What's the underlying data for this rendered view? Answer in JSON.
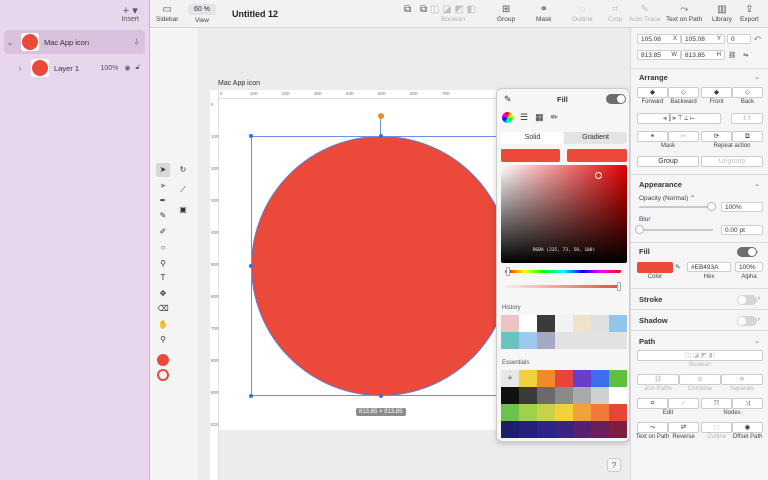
{
  "layers_panel": {
    "insert_label": "Insert",
    "rows": [
      {
        "name": "Mac App icon",
        "opacity": ""
      },
      {
        "name": "Layer 1",
        "opacity": "100%"
      }
    ]
  },
  "toolbar": {
    "sidebar": "Sidebar",
    "zoom_value": "60 %",
    "view": "View",
    "document_title": "Untitled 12",
    "boolean": "Boolean",
    "group": "Group",
    "mask": "Mask",
    "outline": "Outline",
    "crop": "Crop",
    "auto_trace": "Auto Trace",
    "text_on_path": "Text on Path",
    "library": "Library",
    "export": "Export"
  },
  "canvas": {
    "artboard_label": "Mac App icon",
    "size_badge": "813.85 × 813.85",
    "ruler_h": [
      "0",
      "100",
      "200",
      "300",
      "400",
      "500",
      "600",
      "700"
    ],
    "ruler_v": [
      "0",
      "100",
      "200",
      "300",
      "400",
      "500",
      "600",
      "700",
      "800",
      "900",
      "1024"
    ]
  },
  "fill_popover": {
    "title": "Fill",
    "tab_solid": "Solid",
    "tab_gradient": "Gradient",
    "rgba_label": "RGBA (235, 73, 58, 100)",
    "history_label": "History",
    "essentials_label": "Essentials",
    "current_color": "#EB493A",
    "history_colors": [
      "#ecc4c4",
      "#ffffff",
      "#3a3a3a",
      "#f2f2f2",
      "#ece3c8",
      "#e0e0e0",
      "#92c5ea",
      "#6cc2c1",
      "#9ec7f2",
      "#a3a9c2",
      "#e2e2e2",
      "#e2e2e2",
      "#e2e2e2",
      "#e2e2e2"
    ],
    "essential_colors": [
      "#f2d13a",
      "#f08a2c",
      "#e6453a",
      "#6a3fc8",
      "#3a6ff0",
      "#5cc23a",
      "#111111",
      "#3a3a3a",
      "#6a6a6a",
      "#8a8a8a",
      "#a9a9a9",
      "#d0d0d0",
      "#ffffff",
      "#6cc24a",
      "#9fd24a",
      "#c7d24a",
      "#f2d13a",
      "#f2a23a",
      "#f07a3a",
      "#e6453a",
      "#1e1f6a",
      "#26207a",
      "#2d2585",
      "#3a2480",
      "#552070",
      "#6a1f5a",
      "#7a1f3f"
    ]
  },
  "inspector": {
    "x": "105.08",
    "x_sfx": "X",
    "y": "105.08",
    "y_sfx": "Y",
    "rotation": "0",
    "w": "813.85",
    "w_sfx": "W",
    "h": "813.85",
    "h_sfx": "H",
    "arrange": "Arrange",
    "forward": "Forward",
    "backward": "Backward",
    "front": "Front",
    "back": "Back",
    "mask": "Mask",
    "repeat_action": "Repeat action",
    "group": "Group",
    "ungroup": "Ungroup",
    "appearance": "Appearance",
    "opacity_label": "Opacity (Normal)",
    "opacity_value": "100%",
    "blur_label": "Blur",
    "blur_value": "0.00 pt",
    "fill": "Fill",
    "hex_value": "#EB493A",
    "alpha_value": "100%",
    "color_cap": "Color",
    "hex_cap": "Hex",
    "alpha_cap": "Alpha",
    "stroke": "Stroke",
    "shadow": "Shadow",
    "path": "Path",
    "boolean": "Boolean",
    "join_paths": "Join Paths",
    "combine": "Combine",
    "separate": "Separate",
    "edit": "Edit",
    "nodes": "Nodes",
    "text_on_path": "Text on Path",
    "reverse": "Reverse",
    "outline": "Outline",
    "offset_path": "Offset Path",
    "accent_fill": "#EB4939"
  }
}
